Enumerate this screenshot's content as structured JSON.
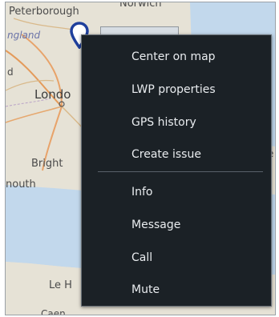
{
  "map": {
    "labels": {
      "peterborough": "Peterborough",
      "norwich": "Norwich",
      "england": "ngland",
      "d": "d",
      "london": "Londo",
      "brighton": "Bright",
      "mouth": "nouth",
      "leh": "Le H",
      "caen": "Caen",
      "right_e": "e"
    },
    "pin_color": "#1f3f9c"
  },
  "context_menu": {
    "items": [
      {
        "id": "center-on-map",
        "label": "Center on map"
      },
      {
        "id": "lwp-properties",
        "label": "LWP properties"
      },
      {
        "id": "gps-history",
        "label": "GPS history"
      },
      {
        "id": "create-issue",
        "label": "Create issue"
      },
      {
        "id": "info",
        "label": "Info"
      },
      {
        "id": "message",
        "label": "Message"
      },
      {
        "id": "call",
        "label": "Call"
      },
      {
        "id": "mute",
        "label": "Mute"
      }
    ]
  },
  "colors": {
    "menu_bg": "#1b2126",
    "menu_text": "#e9ecef",
    "map_bg": "#e8e4da",
    "water": "#c2d8ec"
  }
}
